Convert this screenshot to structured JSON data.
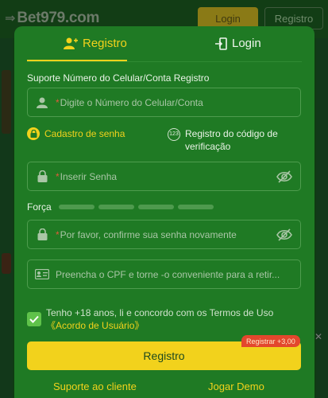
{
  "background": {
    "logo_text": "Bet979.com",
    "login_label": "Login",
    "register_label": "Registro"
  },
  "tabs": {
    "register_label": "Registro",
    "login_label": "Login"
  },
  "form": {
    "section_label": "Suporte Número do Celular/Conta Registro",
    "phone_placeholder": "Digite o Número do Celular/Conta",
    "option_password": "Cadastro de senha",
    "option_code": "Registro do código de verificação",
    "password_placeholder": "Inserir Senha",
    "strength_label": "Força",
    "confirm_placeholder": "Por favor, confirme sua senha novamente",
    "cpf_placeholder": "Preencha o CPF e torne -o conveniente para a retir...",
    "required_mark": "*",
    "terms_text": "Tenho +18 anos, li e concordo com os Termos de Uso",
    "terms_link": "《Acordo de Usuário》",
    "submit_label": "Registro",
    "bonus_badge": "Registrar +3,00"
  },
  "footer": {
    "support_label": "Suporte ao cliente",
    "demo_label": "Jogar Demo"
  },
  "colors": {
    "panel": "#1f7a24",
    "accent": "#f2d21c",
    "bonus": "#e3472d"
  }
}
